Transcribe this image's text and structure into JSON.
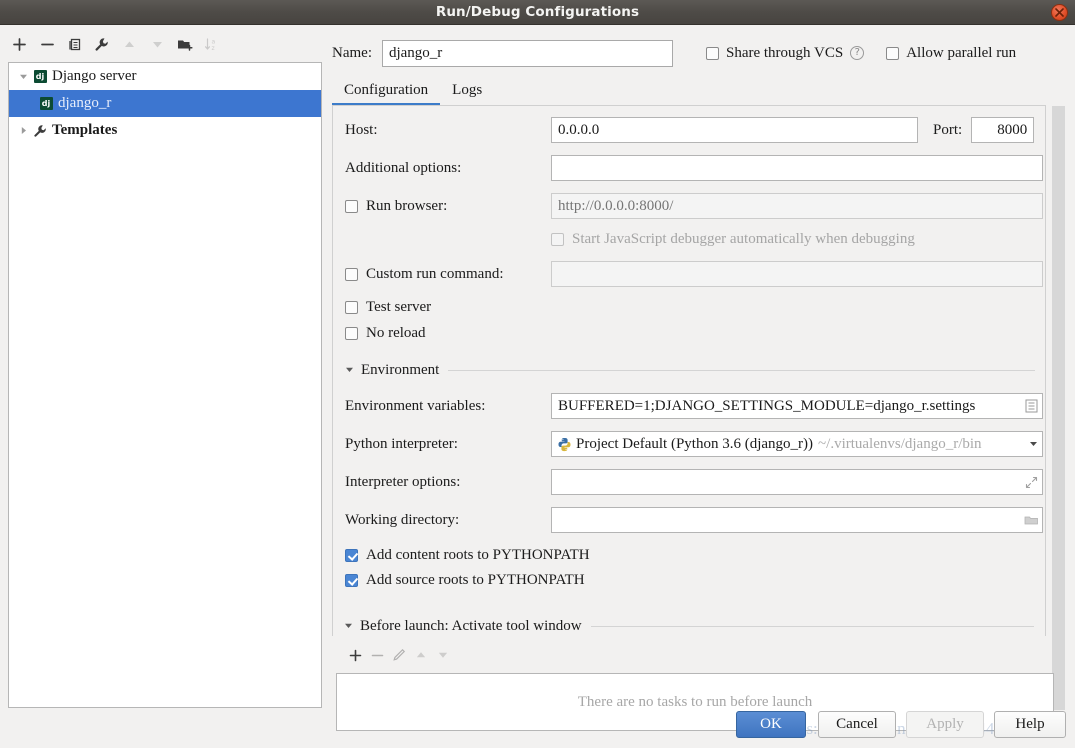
{
  "window": {
    "title": "Run/Debug Configurations",
    "close_icon": "close-icon"
  },
  "left_toolbar": {
    "items": [
      {
        "name": "add-configuration-button",
        "glyph": "plus",
        "enabled": true
      },
      {
        "name": "remove-configuration-button",
        "glyph": "minus",
        "enabled": true
      },
      {
        "name": "copy-configuration-button",
        "glyph": "copy",
        "enabled": true
      },
      {
        "name": "edit-templates-button",
        "glyph": "wrench",
        "enabled": true
      },
      {
        "name": "move-up-button",
        "glyph": "triangle-up",
        "enabled": false
      },
      {
        "name": "move-down-button",
        "glyph": "triangle-down",
        "enabled": false
      },
      {
        "name": "new-folder-button",
        "glyph": "folder-add",
        "enabled": true
      },
      {
        "name": "sort-configurations-button",
        "glyph": "sort-az",
        "enabled": false
      }
    ]
  },
  "tree": {
    "nodes": [
      {
        "label": "Django server",
        "icon": "django-icon",
        "indent": 0,
        "expander": "down",
        "selected": false
      },
      {
        "label": "django_r",
        "icon": "django-icon",
        "indent": 1,
        "expander": "none",
        "selected": true
      },
      {
        "label": "Templates",
        "icon": "wrench-icon",
        "indent": 0,
        "expander": "right",
        "selected": false
      }
    ]
  },
  "header": {
    "name_label": "Name:",
    "name_value": "django_r",
    "name_placeholder": "",
    "share_vcs_label": "Share through VCS",
    "share_vcs_checked": false,
    "help_icon": "question-mark-icon",
    "allow_parallel_label": "Allow parallel run",
    "allow_parallel_checked": false
  },
  "tabs": [
    {
      "label": "Configuration",
      "active": true
    },
    {
      "label": "Logs",
      "active": false
    }
  ],
  "form": {
    "host_label": "Host:",
    "host_value": "0.0.0.0",
    "port_label": "Port:",
    "port_value": "8000",
    "additional_options_label": "Additional options:",
    "additional_options_value": "",
    "run_browser_label": "Run browser:",
    "run_browser_checked": false,
    "run_browser_url": "http://0.0.0.0:8000/",
    "js_debugger_label": "Start JavaScript debugger automatically when debugging",
    "js_debugger_checked": false,
    "custom_run_command_label": "Custom run command:",
    "custom_run_command_checked": false,
    "custom_run_command_value": "",
    "test_server_label": "Test server",
    "test_server_checked": false,
    "no_reload_label": "No reload",
    "no_reload_checked": false
  },
  "environment": {
    "section_title": "Environment",
    "env_vars_label": "Environment variables:",
    "env_vars_value": "BUFFERED=1;DJANGO_SETTINGS_MODULE=django_r.settings",
    "env_vars_button_icon": "browse-list-icon",
    "interpreter_label": "Python interpreter:",
    "interpreter_icon": "python-icon",
    "interpreter_value": "Project Default (Python 3.6 (django_r))",
    "interpreter_path": "~/.virtualenvs/django_r/bin",
    "interpreter_arrow_icon": "chevron-down-icon",
    "interpreter_options_label": "Interpreter options:",
    "interpreter_options_value": "",
    "interpreter_options_button_icon": "expand-icon",
    "working_directory_label": "Working directory:",
    "working_directory_value": "",
    "working_directory_button_icon": "folder-icon",
    "add_content_roots_label": "Add content roots to PYTHONPATH",
    "add_content_roots_checked": true,
    "add_source_roots_label": "Add source roots to PYTHONPATH",
    "add_source_roots_checked": true
  },
  "before_launch": {
    "section_title": "Before launch: Activate tool window",
    "toolbar": [
      {
        "name": "add-task-button",
        "glyph": "plus",
        "enabled": true
      },
      {
        "name": "remove-task-button",
        "glyph": "minus",
        "enabled": false
      },
      {
        "name": "edit-task-button",
        "glyph": "pencil",
        "enabled": false
      },
      {
        "name": "move-task-up-button",
        "glyph": "triangle-up",
        "enabled": false
      },
      {
        "name": "move-task-down-button",
        "glyph": "triangle-down",
        "enabled": false
      }
    ],
    "empty_text": "There are no tasks to run before launch"
  },
  "buttons": {
    "ok": "OK",
    "cancel": "Cancel",
    "apply": "Apply",
    "help": "Help"
  },
  "watermark": {
    "text": "https://blog.csdn.net/weixin_44410774"
  },
  "colors": {
    "accent": "#3d76d0",
    "titlebar": "#4e4b47",
    "panel": "#f2f1f0",
    "selection": "#3d76d0",
    "close": "#e2502a"
  }
}
